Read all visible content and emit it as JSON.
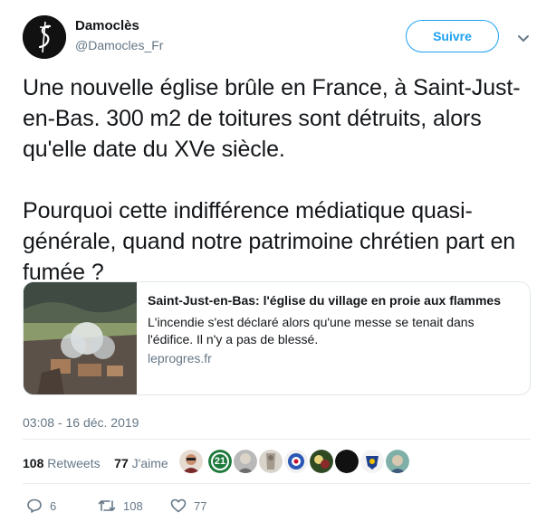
{
  "author": {
    "display_name": "Damoclès",
    "handle": "@Damocles_Fr",
    "avatar_icon": "sword-logo-icon"
  },
  "follow_button": {
    "label": "Suivre"
  },
  "menu": {
    "icon": "chevron-down-icon"
  },
  "tweet": {
    "text": "Une nouvelle église brûle en France, à Saint-Just-en-Bas. 300 m2 de toitures sont détruits, alors qu'elle date du XVe siècle.\n\nPourquoi cette indifférence médiatique quasi-générale, quand notre patrimoine chrétien part en fumée ?"
  },
  "card": {
    "title": "Saint-Just-en-Bas: l'église du village en proie aux flammes",
    "description": "L'incendie s'est déclaré alors qu'une messe se tenait dans l'édifice. Il n'y a pas de blessé.",
    "domain": "leprogres.fr"
  },
  "timestamp": "03:08 - 16 déc. 2019",
  "stats": {
    "retweets_count": "108",
    "retweets_label": "Retweets",
    "likes_count": "77",
    "likes_label": "J'aime"
  },
  "likers": [
    {
      "icon": "user-avatar-icon",
      "text": ""
    },
    {
      "icon": "user-avatar-icon",
      "text": "21"
    },
    {
      "icon": "user-avatar-icon",
      "text": ""
    },
    {
      "icon": "user-avatar-icon",
      "text": ""
    },
    {
      "icon": "user-avatar-icon",
      "text": ""
    },
    {
      "icon": "user-avatar-icon",
      "text": ""
    },
    {
      "icon": "user-avatar-icon",
      "text": ""
    },
    {
      "icon": "user-avatar-icon",
      "text": ""
    },
    {
      "icon": "user-avatar-icon",
      "text": ""
    }
  ],
  "actions": {
    "reply_count": "6",
    "retweet_count": "108",
    "like_count": "77"
  },
  "colors": {
    "accent": "#1da1f2",
    "secondary_text": "#657786",
    "primary_text": "#14171a"
  }
}
